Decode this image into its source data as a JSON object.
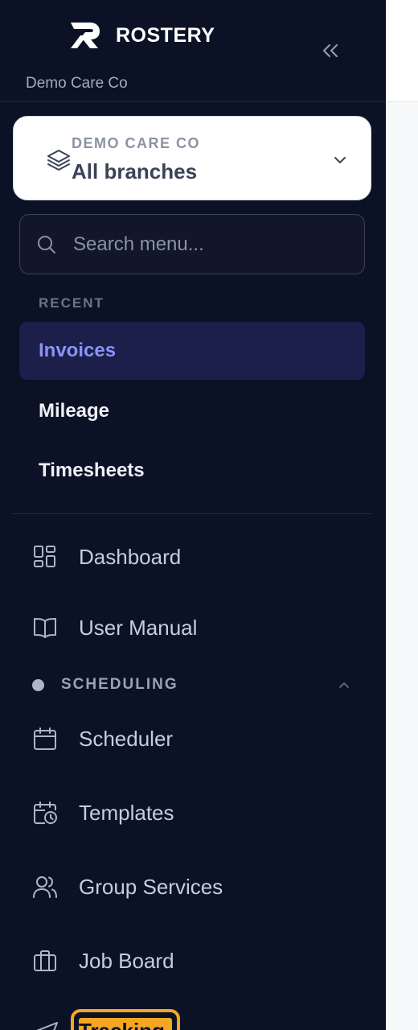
{
  "app": {
    "brand": "ROSTERY",
    "org_name": "Demo Care Co"
  },
  "branch_selector": {
    "org_label": "DEMO CARE CO",
    "branch": "All branches"
  },
  "search": {
    "placeholder": "Search menu..."
  },
  "recent": {
    "label": "RECENT",
    "items": [
      {
        "label": "Invoices",
        "active": true
      },
      {
        "label": "Mileage",
        "active": false
      },
      {
        "label": "Timesheets",
        "active": false
      }
    ]
  },
  "nav": {
    "dashboard": {
      "label": "Dashboard",
      "icon": "dashboard-grid-icon"
    },
    "user_manual": {
      "label": "User Manual",
      "icon": "open-book-icon"
    }
  },
  "scheduling": {
    "label": "SCHEDULING",
    "expanded": true,
    "items": [
      {
        "label": "Scheduler",
        "icon": "calendar-icon"
      },
      {
        "label": "Templates",
        "icon": "calendar-clock-icon"
      },
      {
        "label": "Group Services",
        "icon": "users-icon"
      },
      {
        "label": "Job Board",
        "icon": "briefcase-icon"
      },
      {
        "label": "Tracking",
        "icon": "send-icon"
      }
    ]
  },
  "colors": {
    "sidebar_bg": "#0c1226",
    "active_bg": "#1b1f4a",
    "active_text": "#8b93f5",
    "highlight": "#f5a623"
  }
}
